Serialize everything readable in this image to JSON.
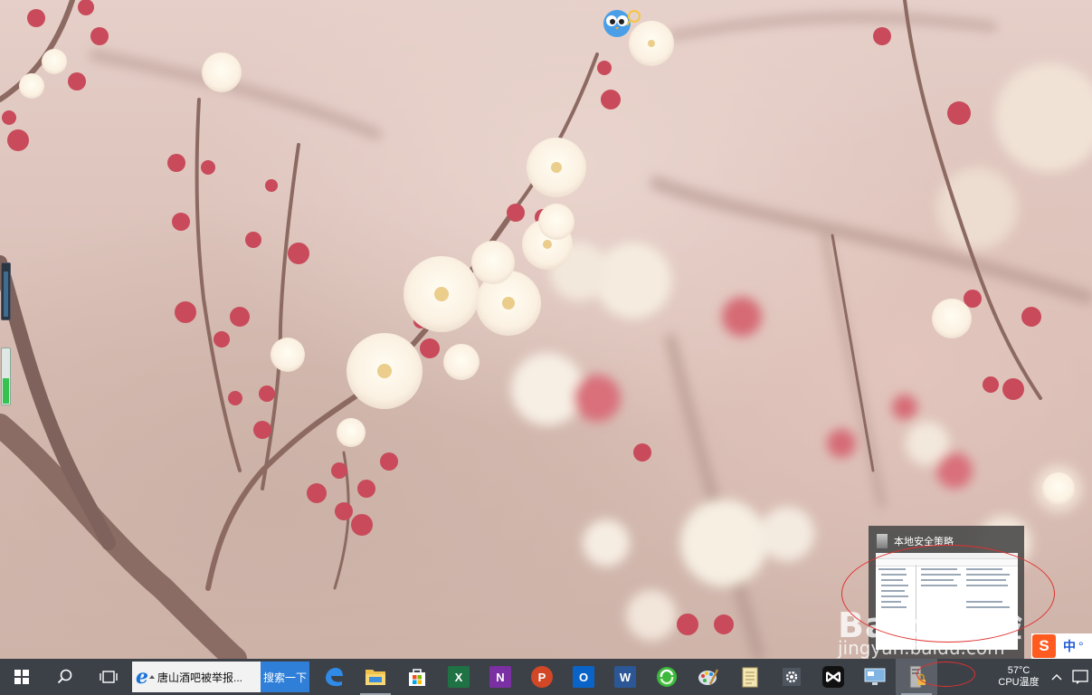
{
  "desktop": {
    "gadget_level": 0.45
  },
  "thumbnail": {
    "title": "本地安全策略"
  },
  "watermark": {
    "main": "Baidu经验",
    "url": "jingyan.baidu.com"
  },
  "ime": {
    "logo": "S",
    "mode": "中"
  },
  "taskbar": {
    "search_box_text": "唐山酒吧被举报...",
    "search_button": "搜索一下",
    "apps": [
      {
        "name": "edge",
        "icon": "edge-icon"
      },
      {
        "name": "file-explorer",
        "icon": "folder-icon"
      },
      {
        "name": "store",
        "icon": "store-icon"
      },
      {
        "name": "excel",
        "icon": "excel-icon",
        "letter": "X",
        "color": "#1f7244"
      },
      {
        "name": "onenote",
        "icon": "onenote-icon",
        "letter": "N",
        "color": "#7a2fa3"
      },
      {
        "name": "powerpoint",
        "icon": "powerpoint-icon",
        "letter": "P",
        "color": "#d24726"
      },
      {
        "name": "outlook",
        "icon": "outlook-icon",
        "letter": "O",
        "color": "#0a64c7"
      },
      {
        "name": "word",
        "icon": "word-icon",
        "letter": "W",
        "color": "#2b5796"
      },
      {
        "name": "360-browser",
        "icon": "browser-360-icon"
      },
      {
        "name": "paint",
        "icon": "paint-palette-icon"
      },
      {
        "name": "notepad",
        "icon": "notepad-icon"
      },
      {
        "name": "settings",
        "icon": "gear-icon"
      },
      {
        "name": "capcut",
        "icon": "capcut-icon"
      },
      {
        "name": "remote-desktop",
        "icon": "remote-desktop-icon"
      },
      {
        "name": "local-security-policy",
        "icon": "security-policy-icon"
      }
    ],
    "tray": {
      "temperature": "57°C",
      "temperature_label": "CPU温度"
    }
  },
  "colors": {
    "taskbar_bg": "#3c4148",
    "search_button_bg": "#2f7fd8",
    "highlight_red": "#e0302e"
  }
}
